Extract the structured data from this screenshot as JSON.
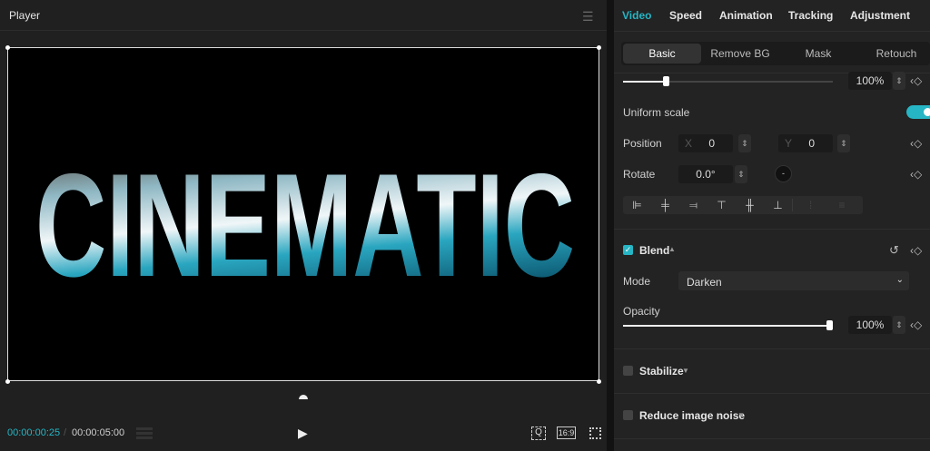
{
  "player": {
    "title": "Player",
    "headline": "CINEMATIC",
    "current_time": "00:00:00:25",
    "separator": "/",
    "duration": "00:00:05:00",
    "aspect_ratio": "16:9",
    "icons": [
      "menu-icon",
      "play-icon",
      "zoom-fit-icon",
      "fullscreen-icon"
    ]
  },
  "tabs": [
    {
      "label": "Video",
      "active": true
    },
    {
      "label": "Speed"
    },
    {
      "label": "Animation"
    },
    {
      "label": "Tracking"
    },
    {
      "label": "Adjustment"
    }
  ],
  "subtabs": [
    {
      "label": "Basic",
      "active": true
    },
    {
      "label": "Remove BG"
    },
    {
      "label": "Mask"
    },
    {
      "label": "Retouch"
    }
  ],
  "scale": {
    "value": "100%",
    "percent": 100,
    "slider_fraction": 0.21
  },
  "uniform_scale": {
    "label": "Uniform scale",
    "on": true
  },
  "position": {
    "label": "Position",
    "x_label": "X",
    "x": "0",
    "y_label": "Y",
    "y": "0"
  },
  "rotate": {
    "label": "Rotate",
    "value": "0.0°"
  },
  "blend": {
    "label": "Blend",
    "checked": true,
    "mode_label": "Mode",
    "mode": "Darken",
    "opacity_label": "Opacity",
    "opacity": "100%",
    "opacity_fraction": 1.0
  },
  "stabilize": {
    "label": "Stabilize",
    "checked": false
  },
  "noise": {
    "label": "Reduce image noise",
    "checked": false
  },
  "colors": {
    "accent": "#26b5c4",
    "panel": "#232323",
    "player": "#202020"
  }
}
